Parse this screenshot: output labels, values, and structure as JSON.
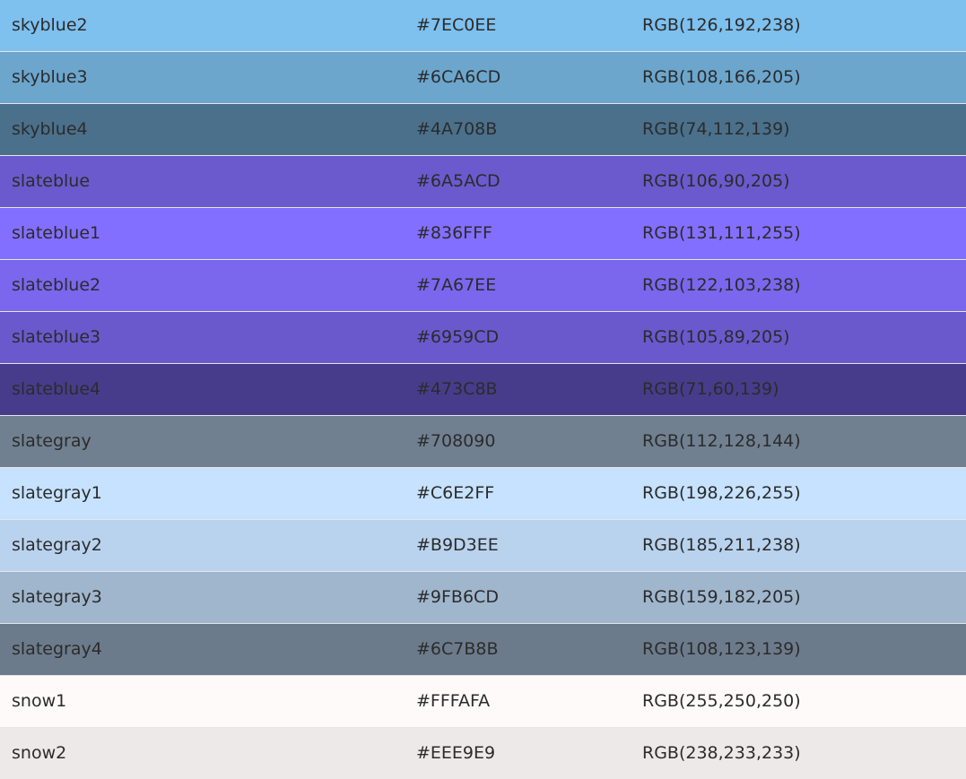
{
  "rows": [
    {
      "name": "skyblue2",
      "hex": "#7EC0EE",
      "rgb": "RGB(126,192,238)",
      "bg": "#7EC0EE"
    },
    {
      "name": "skyblue3",
      "hex": "#6CA6CD",
      "rgb": "RGB(108,166,205)",
      "bg": "#6CA6CD"
    },
    {
      "name": "skyblue4",
      "hex": "#4A708B",
      "rgb": "RGB(74,112,139)",
      "bg": "#4A708B"
    },
    {
      "name": "slateblue",
      "hex": "#6A5ACD",
      "rgb": "RGB(106,90,205)",
      "bg": "#6A5ACD"
    },
    {
      "name": "slateblue1",
      "hex": "#836FFF",
      "rgb": "RGB(131,111,255)",
      "bg": "#836FFF"
    },
    {
      "name": "slateblue2",
      "hex": "#7A67EE",
      "rgb": "RGB(122,103,238)",
      "bg": "#7A67EE"
    },
    {
      "name": "slateblue3",
      "hex": "#6959CD",
      "rgb": "RGB(105,89,205)",
      "bg": "#6959CD"
    },
    {
      "name": "slateblue4",
      "hex": "#473C8B",
      "rgb": "RGB(71,60,139)",
      "bg": "#473C8B"
    },
    {
      "name": "slategray",
      "hex": "#708090",
      "rgb": "RGB(112,128,144)",
      "bg": "#708090"
    },
    {
      "name": "slategray1",
      "hex": "#C6E2FF",
      "rgb": "RGB(198,226,255)",
      "bg": "#C6E2FF"
    },
    {
      "name": "slategray2",
      "hex": "#B9D3EE",
      "rgb": "RGB(185,211,238)",
      "bg": "#B9D3EE"
    },
    {
      "name": "slategray3",
      "hex": "#9FB6CD",
      "rgb": "RGB(159,182,205)",
      "bg": "#9FB6CD"
    },
    {
      "name": "slategray4",
      "hex": "#6C7B8B",
      "rgb": "RGB(108,123,139)",
      "bg": "#6C7B8B"
    },
    {
      "name": "snow1",
      "hex": "#FFFAFA",
      "rgb": "RGB(255,250,250)",
      "bg": "#FFFAFA"
    },
    {
      "name": "snow2",
      "hex": "#EEE9E9",
      "rgb": "RGB(238,233,233)",
      "bg": "#EEE9E9"
    }
  ]
}
